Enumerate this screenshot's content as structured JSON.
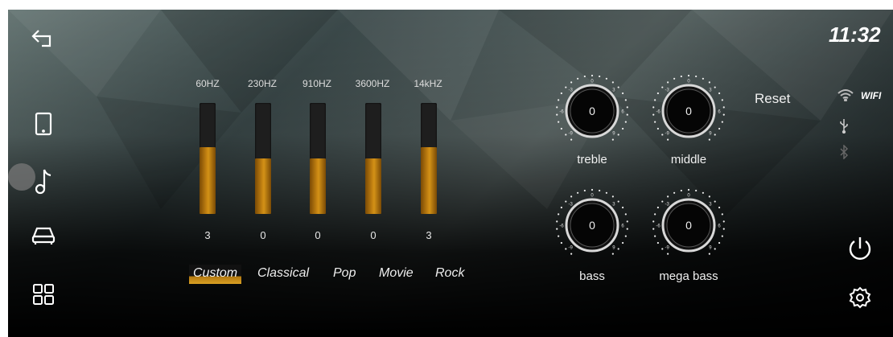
{
  "status": {
    "time": "11:32",
    "wifi_label": "WIFI"
  },
  "sidebar": {
    "items": [
      {
        "icon": "back-arrow-icon"
      },
      {
        "icon": "phone-icon"
      },
      {
        "icon": "music-note-icon"
      },
      {
        "icon": "car-icon"
      },
      {
        "icon": "apps-grid-icon"
      }
    ]
  },
  "equalizer": {
    "bands": [
      {
        "label": "60HZ",
        "value": "3",
        "level": 0.6
      },
      {
        "label": "230HZ",
        "value": "0",
        "level": 0.5
      },
      {
        "label": "910HZ",
        "value": "0",
        "level": 0.5
      },
      {
        "label": "3600HZ",
        "value": "0",
        "level": 0.5
      },
      {
        "label": "14kHZ",
        "value": "3",
        "level": 0.6
      }
    ],
    "presets": [
      "Custom",
      "Classical",
      "Pop",
      "Movie",
      "Rock"
    ],
    "active_preset": "Custom"
  },
  "tone": {
    "reset_label": "Reset",
    "knobs": [
      {
        "label": "treble",
        "value": "0"
      },
      {
        "label": "middle",
        "value": "0"
      },
      {
        "label": "bass",
        "value": "0"
      },
      {
        "label": "mega bass",
        "value": "0"
      }
    ],
    "scale": [
      "0",
      "3",
      "6",
      "9",
      "-3",
      "-6",
      "-9"
    ]
  },
  "colors": {
    "slider_fill": "#c68412",
    "accent": "#d9a023"
  }
}
